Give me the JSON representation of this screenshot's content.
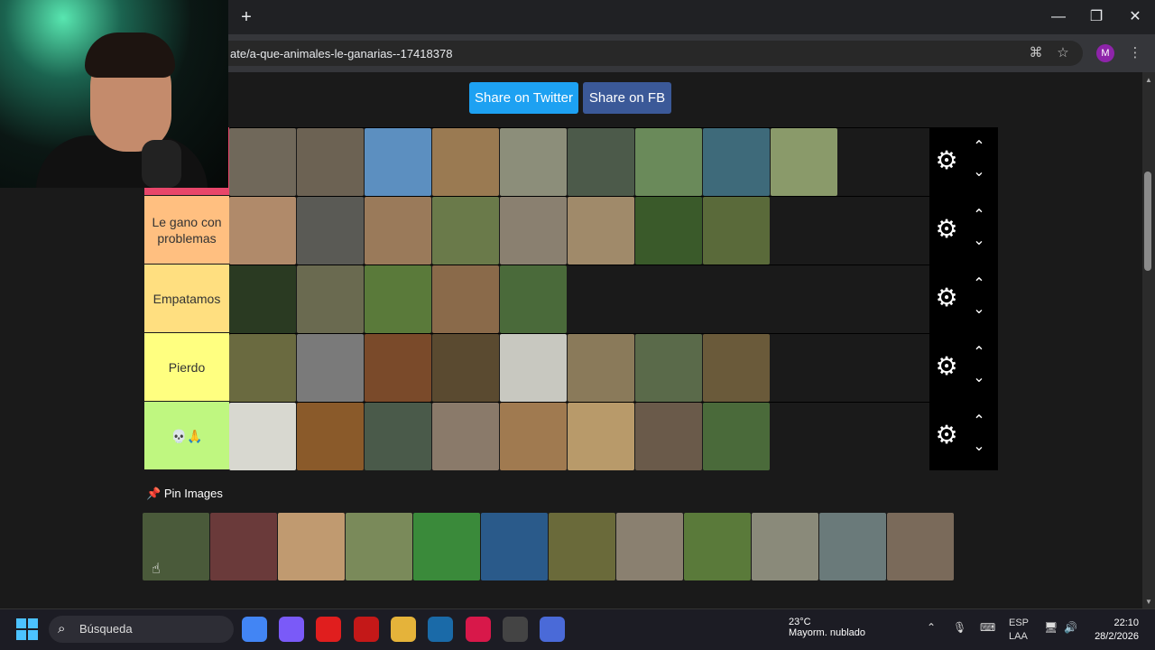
{
  "browser": {
    "new_tab": "+",
    "url": "ate/a-que-animales-le-ganarias--17418378",
    "minimize": "—",
    "restore": "❐",
    "close": "✕",
    "translate_icon": "translate-icon",
    "star_icon": "star-icon",
    "profile_initial": "M",
    "menu_icon": "⋮"
  },
  "page": {
    "share_twitter": "Share on Twitter",
    "share_fb": "Share on FB",
    "tiers": [
      {
        "label": "",
        "color": "#e8466a",
        "count": 9
      },
      {
        "label": "Le gano con problemas",
        "color": "#ffbf80",
        "count": 8
      },
      {
        "label": "Empatamos",
        "color": "#ffdf80",
        "count": 5
      },
      {
        "label": "Pierdo",
        "color": "#ffff80",
        "count": 8
      },
      {
        "label": "💀🙏",
        "color": "#bff780",
        "count": 8
      }
    ],
    "pin_images_title": "Pin Images",
    "pin_images_count": 12
  },
  "taskbar": {
    "search_label": "Búsqueda",
    "weather_temp": "23°C",
    "weather_desc": "Mayorm. nublado",
    "lang": "ESP",
    "lang_sub": "LAA",
    "time": "22:10",
    "date": "28/2/2026"
  }
}
